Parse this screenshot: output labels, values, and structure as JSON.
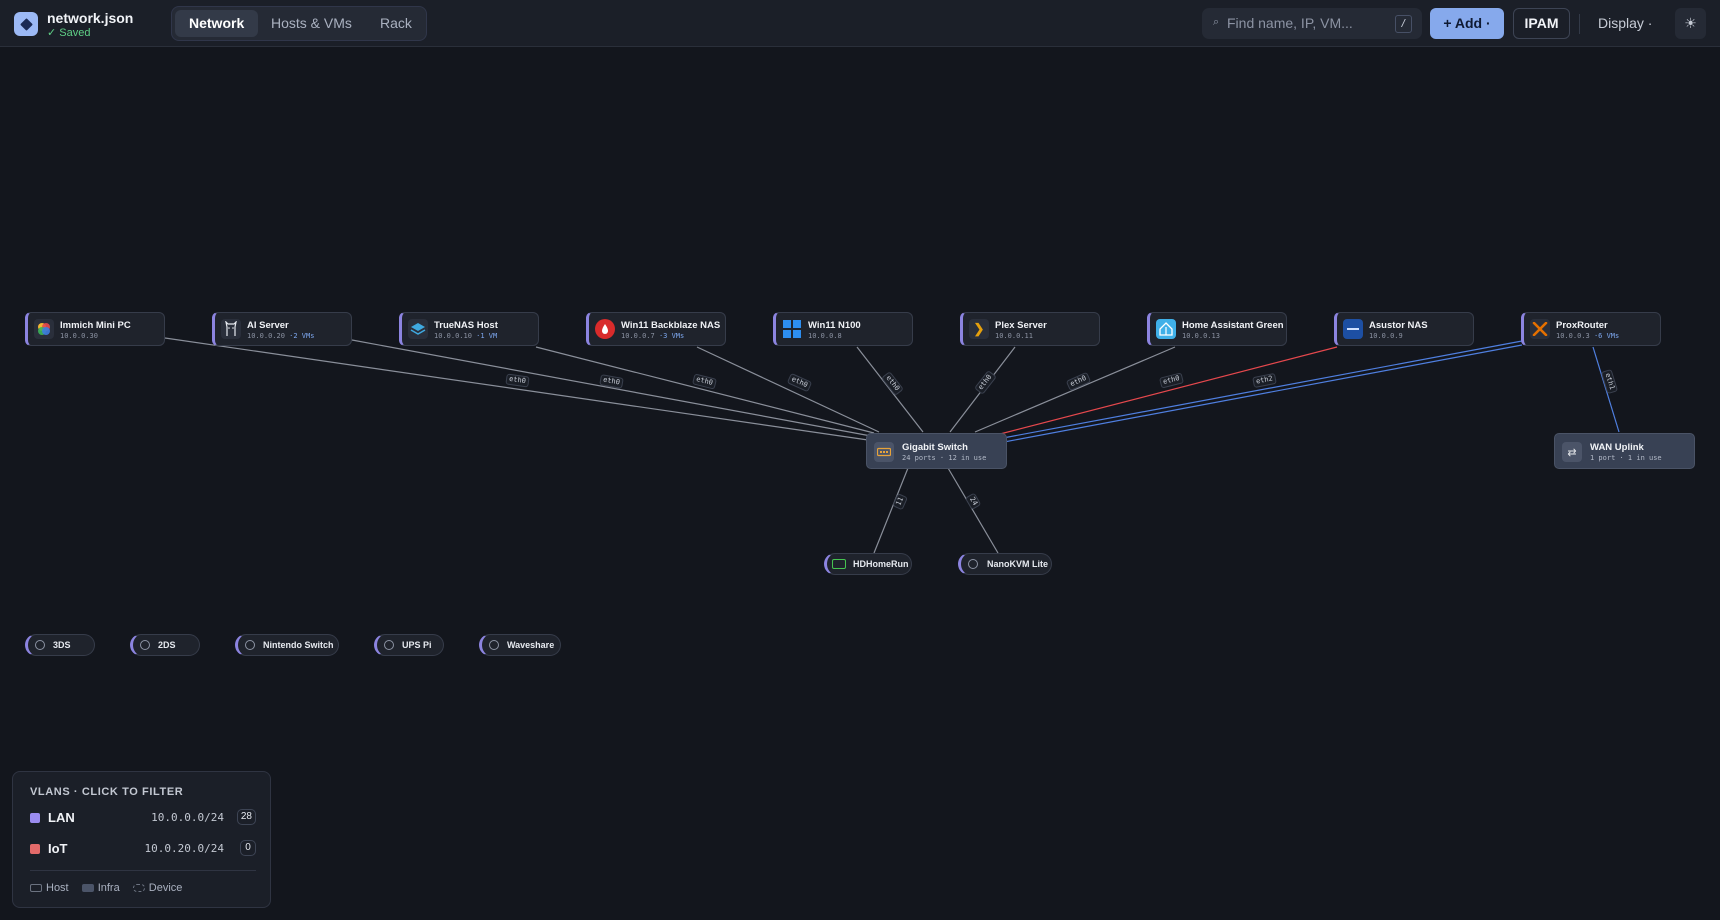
{
  "header": {
    "filename": "network.json",
    "status": "✓ Saved",
    "tabs": [
      "Network",
      "Hosts & VMs",
      "Rack"
    ],
    "active_tab": "Network",
    "search_placeholder": "Find name, IP, VM...",
    "search_shortcut": "/",
    "add_label": "+ Add ·",
    "ipam_label": "IPAM",
    "display_label": "Display ·",
    "theme_icon": "☀"
  },
  "hosts": [
    {
      "name": "Immich Mini PC",
      "ip": "10.0.0.30",
      "vms": "",
      "icon": "immich-icon"
    },
    {
      "name": "AI Server",
      "ip": "10.0.0.20",
      "vms": "·2 VMs",
      "icon": "llama-icon"
    },
    {
      "name": "TrueNAS Host",
      "ip": "10.0.0.10",
      "vms": "·1 VM",
      "icon": "truenas-icon"
    },
    {
      "name": "Win11 Backblaze NAS",
      "ip": "10.0.0.7",
      "vms": "·3 VMs",
      "icon": "backblaze-icon"
    },
    {
      "name": "Win11 N100",
      "ip": "10.0.0.8",
      "vms": "",
      "icon": "windows-icon"
    },
    {
      "name": "Plex Server",
      "ip": "10.0.0.11",
      "vms": "",
      "icon": "plex-icon"
    },
    {
      "name": "Home Assistant Green",
      "ip": "10.0.0.13",
      "vms": "",
      "icon": "home-assistant-icon"
    },
    {
      "name": "Asustor NAS",
      "ip": "10.0.0.9",
      "vms": "",
      "icon": "asustor-icon"
    },
    {
      "name": "ProxRouter",
      "ip": "10.0.0.3",
      "vms": "·6 VMs",
      "icon": "proxmox-icon"
    }
  ],
  "infra": [
    {
      "name": "Gigabit Switch",
      "sub": "24 ports · 12 in use",
      "icon": "switch-icon"
    },
    {
      "name": "WAN Uplink",
      "sub": "1 port · 1 in use",
      "icon": "uplink-icon"
    }
  ],
  "devices": [
    {
      "name": "HDHomeRun",
      "icon": "hdhomerun-icon"
    },
    {
      "name": "NanoKVM Lite",
      "icon": "device-icon"
    },
    {
      "name": "3DS",
      "icon": "device-icon"
    },
    {
      "name": "2DS",
      "icon": "device-icon"
    },
    {
      "name": "Nintendo Switch",
      "icon": "device-icon"
    },
    {
      "name": "UPS Pi",
      "icon": "device-icon"
    },
    {
      "name": "Waveshare",
      "icon": "device-icon"
    }
  ],
  "port_labels": [
    "eth0",
    "eth0",
    "eth0",
    "eth0",
    "eth0",
    "eth0",
    "eth0",
    "eth0",
    "eth0",
    "eth2",
    "eth1",
    "11",
    "24"
  ],
  "vlans": {
    "title": "VLANS · CLICK TO FILTER",
    "items": [
      {
        "name": "LAN",
        "cidr": "10.0.0.0/24",
        "count": "28",
        "color": "#9b8cf0"
      },
      {
        "name": "IoT",
        "cidr": "10.0.20.0/24",
        "count": "0",
        "color": "#e36a6a"
      }
    ],
    "legend": [
      "Host",
      "Infra",
      "Device"
    ]
  },
  "colors": {
    "accent": "#86a9ec",
    "host_border": "#8c84e0",
    "edge_default": "#8a8f9a",
    "edge_iot": "#e5484d",
    "edge_wan": "#4f7fe0"
  }
}
